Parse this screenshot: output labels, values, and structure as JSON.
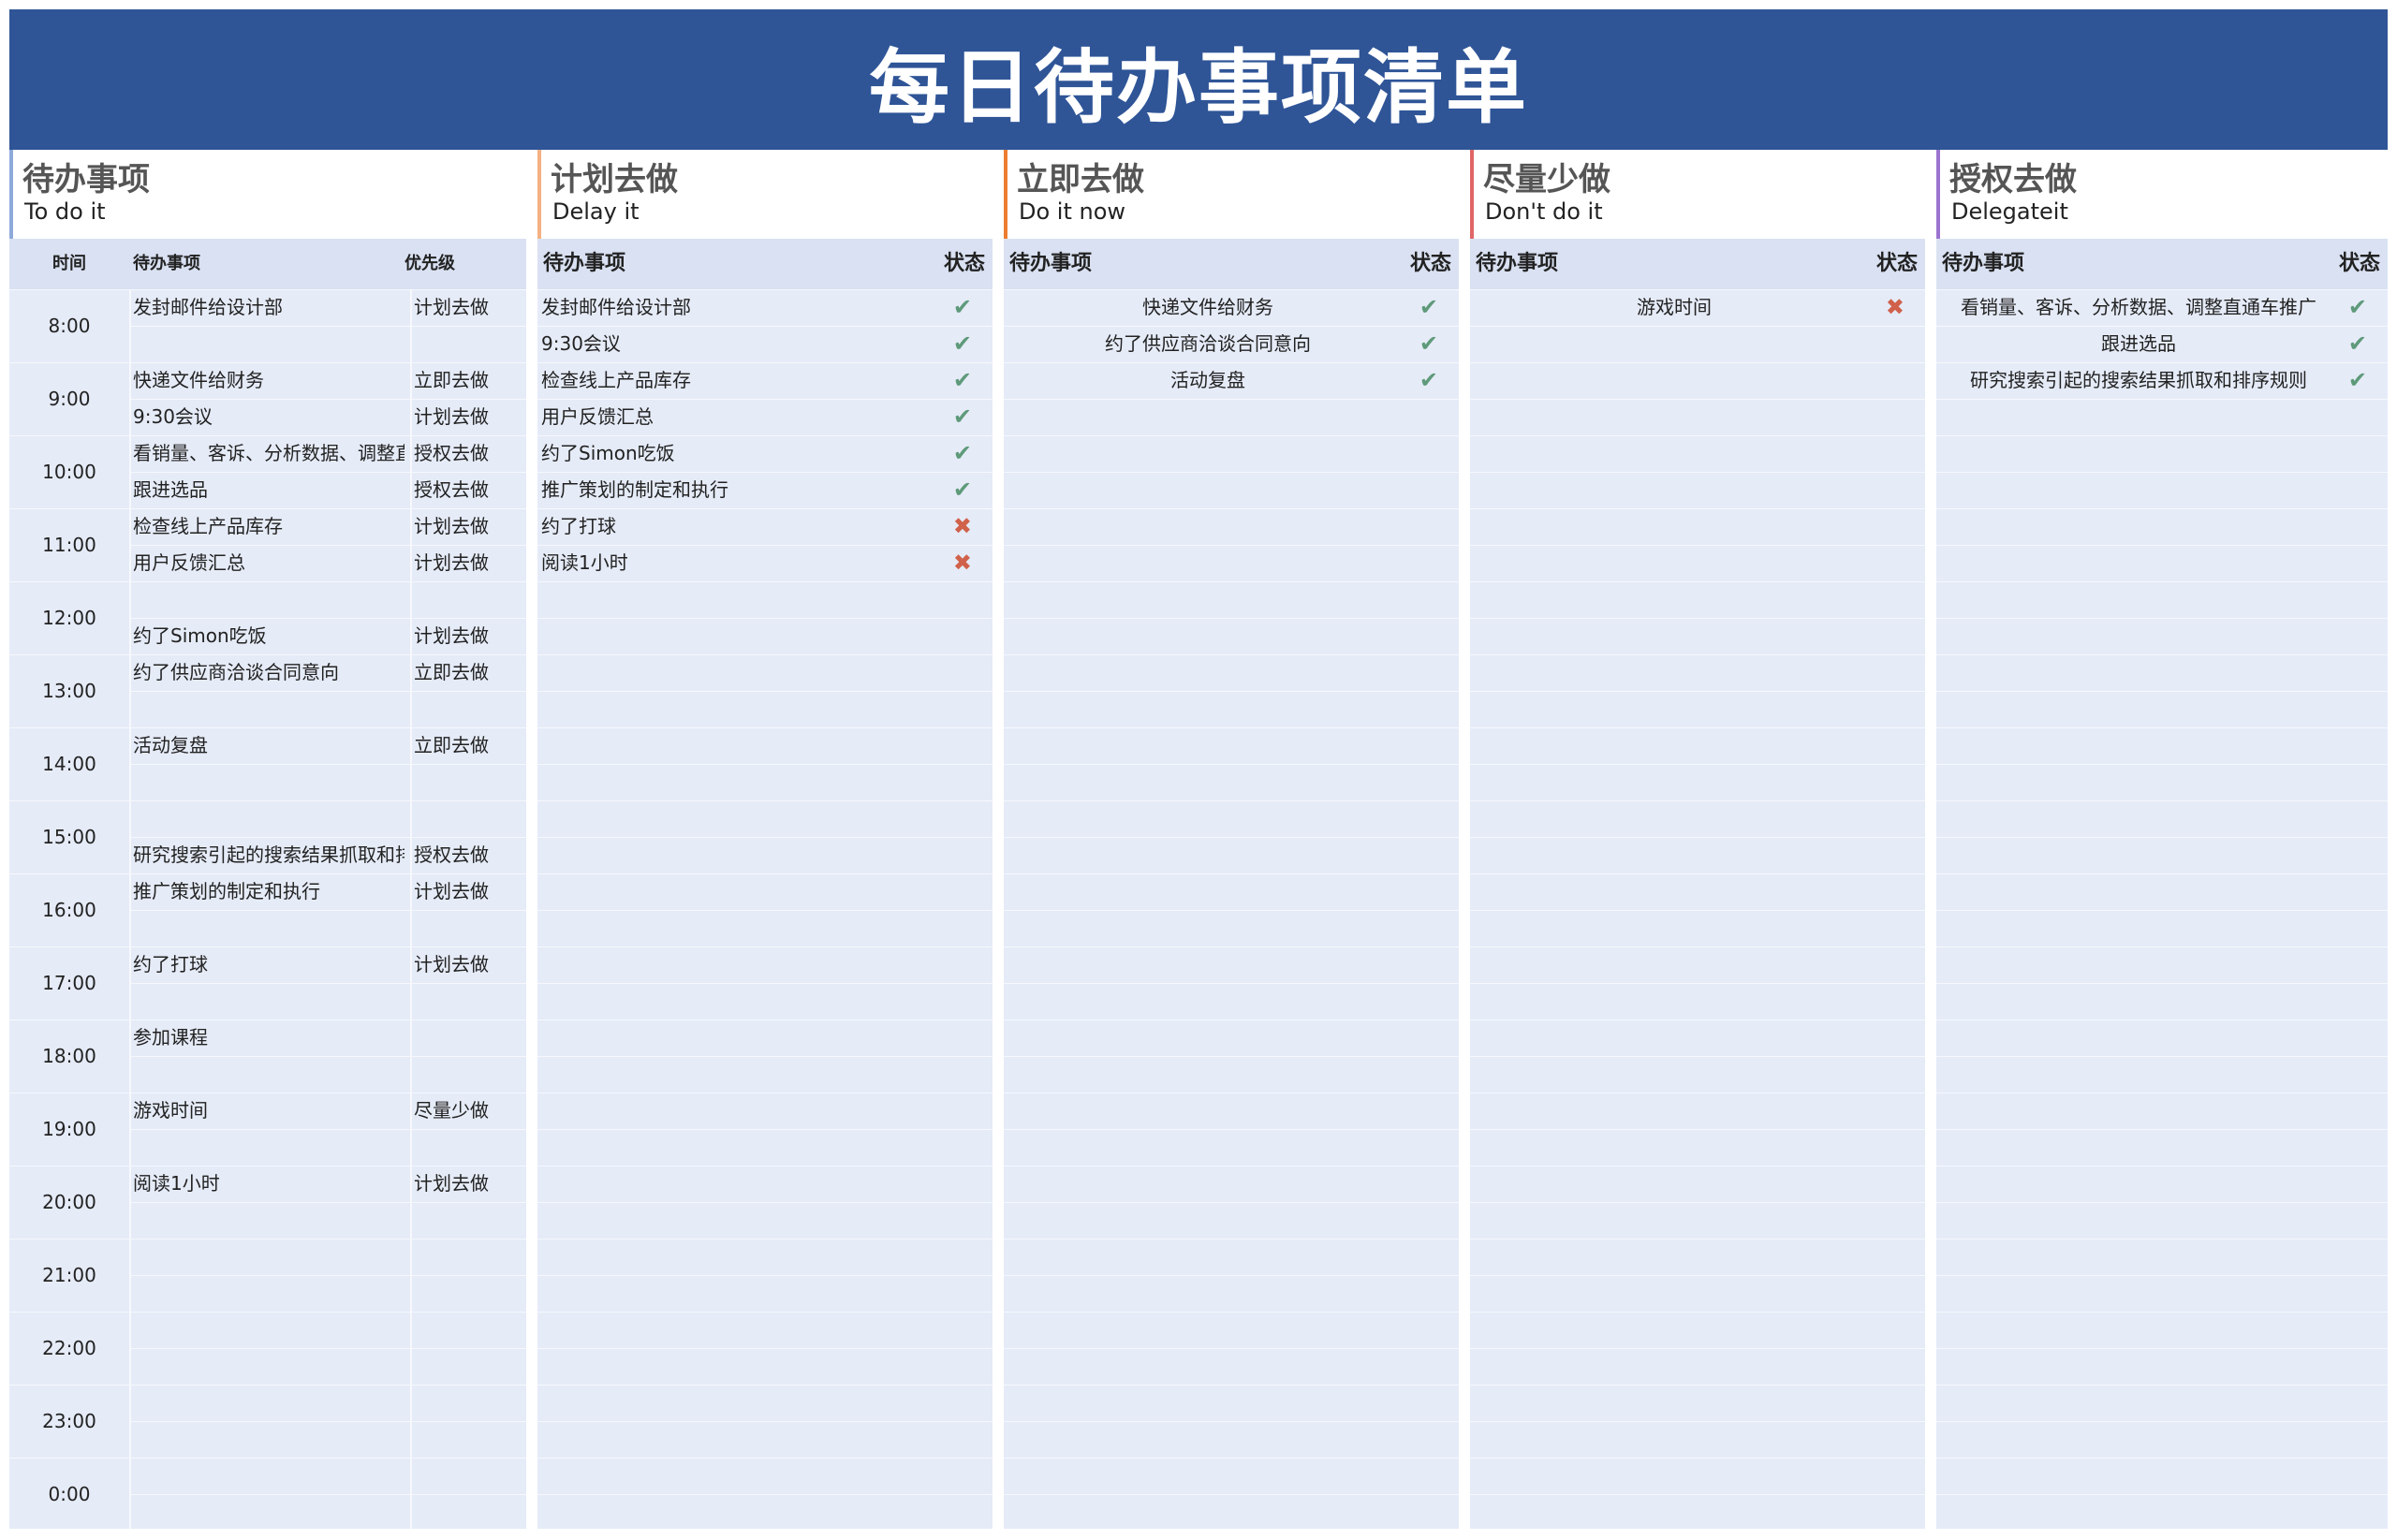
{
  "title": "每日待办事项清单",
  "colors": {
    "banner": "#2f5597",
    "check": "#5e9a7a",
    "cross": "#d0614a"
  },
  "schedule": {
    "title_zh": "待办事项",
    "title_en": "To do it",
    "accent": "#8eaadb",
    "headers": {
      "time": "时间",
      "task": "待办事项",
      "priority": "优先级"
    },
    "times": [
      "8:00",
      "9:00",
      "10:00",
      "11:00",
      "12:00",
      "13:00",
      "14:00",
      "15:00",
      "16:00",
      "17:00",
      "18:00",
      "19:00",
      "20:00",
      "21:00",
      "22:00",
      "23:00",
      "0:00"
    ],
    "rows": [
      {
        "task": "发封邮件给设计部",
        "priority": "计划去做"
      },
      {
        "task": "",
        "priority": ""
      },
      {
        "task": "快递文件给财务",
        "priority": "立即去做"
      },
      {
        "task": "9:30会议",
        "priority": "计划去做"
      },
      {
        "task": "看销量、客诉、分析数据、调整直通车推广",
        "priority": "授权去做"
      },
      {
        "task": "跟进选品",
        "priority": "授权去做"
      },
      {
        "task": "检查线上产品库存",
        "priority": "计划去做"
      },
      {
        "task": "用户反馈汇总",
        "priority": "计划去做"
      },
      {
        "task": "",
        "priority": ""
      },
      {
        "task": "约了Simon吃饭",
        "priority": "计划去做"
      },
      {
        "task": "约了供应商洽谈合同意向",
        "priority": "立即去做"
      },
      {
        "task": "",
        "priority": ""
      },
      {
        "task": "活动复盘",
        "priority": "立即去做"
      },
      {
        "task": "",
        "priority": ""
      },
      {
        "task": "",
        "priority": ""
      },
      {
        "task": "研究搜索引起的搜索结果抓取和排序规则",
        "priority": "授权去做"
      },
      {
        "task": "推广策划的制定和执行",
        "priority": "计划去做"
      },
      {
        "task": "",
        "priority": ""
      },
      {
        "task": "约了打球",
        "priority": "计划去做"
      },
      {
        "task": "",
        "priority": ""
      },
      {
        "task": "参加课程",
        "priority": ""
      },
      {
        "task": "",
        "priority": ""
      },
      {
        "task": "游戏时间",
        "priority": "尽量少做"
      },
      {
        "task": "",
        "priority": ""
      },
      {
        "task": "阅读1小时",
        "priority": "计划去做"
      }
    ]
  },
  "quadrants": [
    {
      "key": "plan",
      "title_zh": "计划去做",
      "title_en": "Delay it",
      "accent": "#f4b183",
      "align": "left",
      "headers": {
        "task": "待办事项",
        "status": "状态"
      },
      "rows": [
        {
          "task": "发封邮件给设计部",
          "status": "done"
        },
        {
          "task": "9:30会议",
          "status": "done"
        },
        {
          "task": "检查线上产品库存",
          "status": "done"
        },
        {
          "task": "用户反馈汇总",
          "status": "done"
        },
        {
          "task": "约了Simon吃饭",
          "status": "done"
        },
        {
          "task": "推广策划的制定和执行",
          "status": "done"
        },
        {
          "task": "约了打球",
          "status": "undone"
        },
        {
          "task": "阅读1小时",
          "status": "undone"
        }
      ]
    },
    {
      "key": "now",
      "title_zh": "立即去做",
      "title_en": "Do it now",
      "accent": "#ed7d31",
      "align": "center",
      "headers": {
        "task": "待办事项",
        "status": "状态"
      },
      "rows": [
        {
          "task": "快递文件给财务",
          "status": "done"
        },
        {
          "task": "约了供应商洽谈合同意向",
          "status": "done"
        },
        {
          "task": "活动复盘",
          "status": "done"
        }
      ]
    },
    {
      "key": "less",
      "title_zh": "尽量少做",
      "title_en": "Don't do it",
      "accent": "#e06666",
      "align": "center",
      "headers": {
        "task": "待办事项",
        "status": "状态"
      },
      "rows": [
        {
          "task": "游戏时间",
          "status": "undone"
        }
      ]
    },
    {
      "key": "delegate",
      "title_zh": "授权去做",
      "title_en": "Delegateit",
      "accent": "#9b72cf",
      "align": "center",
      "headers": {
        "task": "待办事项",
        "status": "状态"
      },
      "rows": [
        {
          "task": "看销量、客诉、分析数据、调整直通车推广",
          "status": "done"
        },
        {
          "task": "跟进选品",
          "status": "done"
        },
        {
          "task": "研究搜索引起的搜索结果抓取和排序规则",
          "status": "done"
        }
      ]
    }
  ],
  "icons": {
    "done": "check-icon",
    "undone": "cross-icon"
  }
}
